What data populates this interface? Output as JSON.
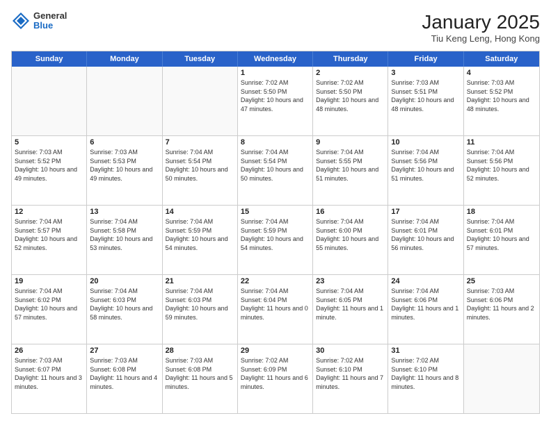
{
  "logo": {
    "general": "General",
    "blue": "Blue"
  },
  "header": {
    "title": "January 2025",
    "subtitle": "Tiu Keng Leng, Hong Kong"
  },
  "days": [
    "Sunday",
    "Monday",
    "Tuesday",
    "Wednesday",
    "Thursday",
    "Friday",
    "Saturday"
  ],
  "weeks": [
    [
      {
        "day": "",
        "empty": true
      },
      {
        "day": "",
        "empty": true
      },
      {
        "day": "",
        "empty": true
      },
      {
        "day": "1",
        "sunrise": "Sunrise: 7:02 AM",
        "sunset": "Sunset: 5:50 PM",
        "daylight": "Daylight: 10 hours and 47 minutes."
      },
      {
        "day": "2",
        "sunrise": "Sunrise: 7:02 AM",
        "sunset": "Sunset: 5:50 PM",
        "daylight": "Daylight: 10 hours and 48 minutes."
      },
      {
        "day": "3",
        "sunrise": "Sunrise: 7:03 AM",
        "sunset": "Sunset: 5:51 PM",
        "daylight": "Daylight: 10 hours and 48 minutes."
      },
      {
        "day": "4",
        "sunrise": "Sunrise: 7:03 AM",
        "sunset": "Sunset: 5:52 PM",
        "daylight": "Daylight: 10 hours and 48 minutes."
      }
    ],
    [
      {
        "day": "5",
        "sunrise": "Sunrise: 7:03 AM",
        "sunset": "Sunset: 5:52 PM",
        "daylight": "Daylight: 10 hours and 49 minutes."
      },
      {
        "day": "6",
        "sunrise": "Sunrise: 7:03 AM",
        "sunset": "Sunset: 5:53 PM",
        "daylight": "Daylight: 10 hours and 49 minutes."
      },
      {
        "day": "7",
        "sunrise": "Sunrise: 7:04 AM",
        "sunset": "Sunset: 5:54 PM",
        "daylight": "Daylight: 10 hours and 50 minutes."
      },
      {
        "day": "8",
        "sunrise": "Sunrise: 7:04 AM",
        "sunset": "Sunset: 5:54 PM",
        "daylight": "Daylight: 10 hours and 50 minutes."
      },
      {
        "day": "9",
        "sunrise": "Sunrise: 7:04 AM",
        "sunset": "Sunset: 5:55 PM",
        "daylight": "Daylight: 10 hours and 51 minutes."
      },
      {
        "day": "10",
        "sunrise": "Sunrise: 7:04 AM",
        "sunset": "Sunset: 5:56 PM",
        "daylight": "Daylight: 10 hours and 51 minutes."
      },
      {
        "day": "11",
        "sunrise": "Sunrise: 7:04 AM",
        "sunset": "Sunset: 5:56 PM",
        "daylight": "Daylight: 10 hours and 52 minutes."
      }
    ],
    [
      {
        "day": "12",
        "sunrise": "Sunrise: 7:04 AM",
        "sunset": "Sunset: 5:57 PM",
        "daylight": "Daylight: 10 hours and 52 minutes."
      },
      {
        "day": "13",
        "sunrise": "Sunrise: 7:04 AM",
        "sunset": "Sunset: 5:58 PM",
        "daylight": "Daylight: 10 hours and 53 minutes."
      },
      {
        "day": "14",
        "sunrise": "Sunrise: 7:04 AM",
        "sunset": "Sunset: 5:59 PM",
        "daylight": "Daylight: 10 hours and 54 minutes."
      },
      {
        "day": "15",
        "sunrise": "Sunrise: 7:04 AM",
        "sunset": "Sunset: 5:59 PM",
        "daylight": "Daylight: 10 hours and 54 minutes."
      },
      {
        "day": "16",
        "sunrise": "Sunrise: 7:04 AM",
        "sunset": "Sunset: 6:00 PM",
        "daylight": "Daylight: 10 hours and 55 minutes."
      },
      {
        "day": "17",
        "sunrise": "Sunrise: 7:04 AM",
        "sunset": "Sunset: 6:01 PM",
        "daylight": "Daylight: 10 hours and 56 minutes."
      },
      {
        "day": "18",
        "sunrise": "Sunrise: 7:04 AM",
        "sunset": "Sunset: 6:01 PM",
        "daylight": "Daylight: 10 hours and 57 minutes."
      }
    ],
    [
      {
        "day": "19",
        "sunrise": "Sunrise: 7:04 AM",
        "sunset": "Sunset: 6:02 PM",
        "daylight": "Daylight: 10 hours and 57 minutes."
      },
      {
        "day": "20",
        "sunrise": "Sunrise: 7:04 AM",
        "sunset": "Sunset: 6:03 PM",
        "daylight": "Daylight: 10 hours and 58 minutes."
      },
      {
        "day": "21",
        "sunrise": "Sunrise: 7:04 AM",
        "sunset": "Sunset: 6:03 PM",
        "daylight": "Daylight: 10 hours and 59 minutes."
      },
      {
        "day": "22",
        "sunrise": "Sunrise: 7:04 AM",
        "sunset": "Sunset: 6:04 PM",
        "daylight": "Daylight: 11 hours and 0 minutes."
      },
      {
        "day": "23",
        "sunrise": "Sunrise: 7:04 AM",
        "sunset": "Sunset: 6:05 PM",
        "daylight": "Daylight: 11 hours and 1 minute."
      },
      {
        "day": "24",
        "sunrise": "Sunrise: 7:04 AM",
        "sunset": "Sunset: 6:06 PM",
        "daylight": "Daylight: 11 hours and 1 minutes."
      },
      {
        "day": "25",
        "sunrise": "Sunrise: 7:03 AM",
        "sunset": "Sunset: 6:06 PM",
        "daylight": "Daylight: 11 hours and 2 minutes."
      }
    ],
    [
      {
        "day": "26",
        "sunrise": "Sunrise: 7:03 AM",
        "sunset": "Sunset: 6:07 PM",
        "daylight": "Daylight: 11 hours and 3 minutes."
      },
      {
        "day": "27",
        "sunrise": "Sunrise: 7:03 AM",
        "sunset": "Sunset: 6:08 PM",
        "daylight": "Daylight: 11 hours and 4 minutes."
      },
      {
        "day": "28",
        "sunrise": "Sunrise: 7:03 AM",
        "sunset": "Sunset: 6:08 PM",
        "daylight": "Daylight: 11 hours and 5 minutes."
      },
      {
        "day": "29",
        "sunrise": "Sunrise: 7:02 AM",
        "sunset": "Sunset: 6:09 PM",
        "daylight": "Daylight: 11 hours and 6 minutes."
      },
      {
        "day": "30",
        "sunrise": "Sunrise: 7:02 AM",
        "sunset": "Sunset: 6:10 PM",
        "daylight": "Daylight: 11 hours and 7 minutes."
      },
      {
        "day": "31",
        "sunrise": "Sunrise: 7:02 AM",
        "sunset": "Sunset: 6:10 PM",
        "daylight": "Daylight: 11 hours and 8 minutes."
      },
      {
        "day": "",
        "empty": true
      }
    ]
  ]
}
